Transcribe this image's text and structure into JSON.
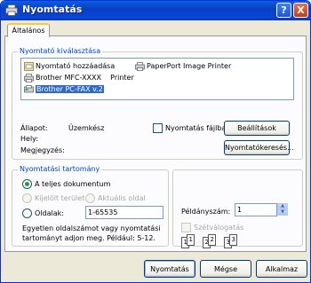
{
  "window": {
    "title": "Nyomtatás"
  },
  "titlebar": {
    "help_label": "?",
    "close_label": "X"
  },
  "tabs": [
    {
      "label": "Általános"
    }
  ],
  "printer_selection": {
    "group_title": "Nyomtató kiválasztása",
    "printers": [
      {
        "label": "Nyomtató hozzáadása",
        "icon": "add-printer-icon"
      },
      {
        "label": "PaperPort Image Printer",
        "icon": "printer-icon"
      },
      {
        "label": "Brother MFC-XXXX    Printer",
        "icon": "printer-icon"
      },
      {
        "label": "Brother PC-FAX v.2",
        "icon": "fax-printer-icon",
        "selected": true
      }
    ],
    "status_label": "Állapot:",
    "status_value": "Üzemkész",
    "location_label": "Hely:",
    "comment_label": "Megjegyzés:",
    "print_to_file_label": "Nyomtatás fájlba",
    "preferences_button": "Beállítások",
    "find_printer_button": "Nyomtatókeresés..."
  },
  "page_range": {
    "group_title": "Nyomtatási tartomány",
    "all_label": "A teljes dokumentum",
    "selection_label": "Kijelölt terület",
    "current_page_label": "Aktuális oldal",
    "pages_label": "Oldalak:",
    "pages_value": "1-65535",
    "hint": [
      "Egyetlen oldalszámot vagy nyomtatási",
      "tartományt adjon meg. Például: 5-12."
    ]
  },
  "copies": {
    "copies_label": "Példányszám:",
    "copies_value": "1",
    "collate_label": "Szétválogatás",
    "collate_pages": [
      "1",
      "1",
      "2",
      "2",
      "3",
      "3"
    ]
  },
  "footer": {
    "print_button": "Nyomtatás",
    "cancel_button": "Mégse",
    "apply_button": "Alkalmaz"
  },
  "colors": {
    "title_bar": "#0a3fc4",
    "group_title": "#0046d5",
    "selection": "#316ac5"
  }
}
